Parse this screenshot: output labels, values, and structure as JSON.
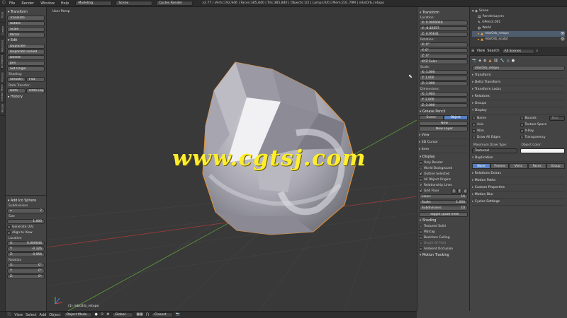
{
  "topbar": {
    "menus": [
      "File",
      "Render",
      "Window",
      "Help"
    ],
    "layout": "Modeling",
    "scene": "Scene",
    "engine": "Cycles Render",
    "stats": "v2.77 | Verts:192,946 | Faces:385,840 | Tris:385,840 | Objects:1/2 | Lamps:0/0 | Mem:231.79M | mbsOrb_retopo"
  },
  "toolshelf_tabs": [
    "Tools",
    "Create",
    "Relations",
    "Animation",
    "Physics",
    "Grease Pencil",
    "Retopo"
  ],
  "tools": {
    "transform_header": "Transform",
    "transform_buttons": [
      "Translate",
      "Rotate",
      "Scale",
      "Mirror"
    ],
    "edit_header": "Edit",
    "edit_buttons": [
      "Duplicate",
      "Duplicate Linked",
      "Delete",
      "Join"
    ],
    "set_origin": "Set Origin",
    "shading_label": "Shading:",
    "smooth": "Smooth",
    "flat": "Flat",
    "data_transfer_label": "Data Transfer:",
    "data": "Data",
    "data_layout": "Data Layo",
    "history": "History"
  },
  "operator": {
    "title": "Add Ico Sphere",
    "subdivisions_label": "Subdivisions",
    "subdivisions": "2",
    "size_label": "Size",
    "size": "1.000",
    "generate_uvs": "Generate UVs",
    "align_to_view": "Align to View",
    "location_label": "Location",
    "loc_x": "0.000046",
    "loc_y": "-0.326",
    "loc_z": "0.956",
    "rotation_label": "Rotation",
    "rot_x": "0°",
    "rot_y": "0°",
    "rot_z": "0°"
  },
  "viewport": {
    "label": "User Persp",
    "object": "(1) mbsOrb_retopo",
    "watermark": "www.cgtsj.com"
  },
  "npanel": {
    "transform": "Transform",
    "location": "Location:",
    "loc": [
      "X: 0.0000046",
      "Y: -0.32557",
      "Z: 0.95641"
    ],
    "rotation": "Rotation:",
    "rot": [
      "X: 0°",
      "Y: 0°",
      "Z: 0°"
    ],
    "rot_mode": "XYZ Euler",
    "scale": "Scale:",
    "scl": [
      "X: 1.000",
      "Y: 1.000",
      "Z: 1.000"
    ],
    "dimensions": "Dimensions:",
    "dim": [
      "X: 1.903",
      "Y: 2.000",
      "Z: 2.000"
    ],
    "grease_pencil": "Grease Pencil",
    "gp_tabs": [
      "Scene",
      "Object"
    ],
    "gp_new": "New",
    "gp_new_layer": "New Layer",
    "view": "View",
    "cursor_3d": "3D Cursor",
    "item": "Item",
    "display": "Display",
    "display_opts": [
      "Only Render",
      "World Background",
      "Outline Selected",
      "All Object Origins",
      "Relationship Lines"
    ],
    "grid_floor": "Grid Floor",
    "axes": [
      "X",
      "Y",
      "Z"
    ],
    "lines": "Lines:",
    "lines_val": "16",
    "scale_lbl": "Scale:",
    "scale_val": "1.000",
    "subdiv_lbl": "Subdivisions:",
    "subdiv_val": "10",
    "quad_view": "Toggle Quad View",
    "shading": "Shading",
    "shading_opts": [
      "Textured Solid",
      "Matcap",
      "Backface Culling",
      "Depth Of Field",
      "Ambient Occlusion"
    ],
    "motion_tracking": "Motion Tracking"
  },
  "outliner": {
    "items": [
      "Scene",
      "RenderLayers",
      "GPencil.001",
      "World",
      "mbsOrb_retopo",
      "mbsOrb_sculpt"
    ],
    "view": "View",
    "search": "Search",
    "all_scenes": "All Scenes"
  },
  "properties": {
    "object_name": "mbsOrb_retopo",
    "panels": [
      "Transform",
      "Delta Transform",
      "Transform Locks",
      "Relations",
      "Groups"
    ],
    "display": "Display",
    "display_left": [
      "Name",
      "Axis",
      "Wire",
      "Draw All Edges"
    ],
    "display_right": [
      "Bounds",
      "Texture Space",
      "X-Ray",
      "Transparency"
    ],
    "box": "Box",
    "max_draw_type": "Maximum Draw Type:",
    "object_color": "Object Color:",
    "textured": "Textured",
    "duplication": "Duplication",
    "dup_tabs": [
      "None",
      "Frames",
      "Verts",
      "Faces",
      "Group"
    ],
    "more_panels": [
      "Relations Extras",
      "Motion Paths",
      "Custom Properties",
      "Motion Blur",
      "Cycles Settings"
    ]
  },
  "bottombar": {
    "menus": [
      "View",
      "Select",
      "Add",
      "Object"
    ],
    "mode": "Object Mode",
    "pivot": "Global",
    "snap": "Closest"
  }
}
